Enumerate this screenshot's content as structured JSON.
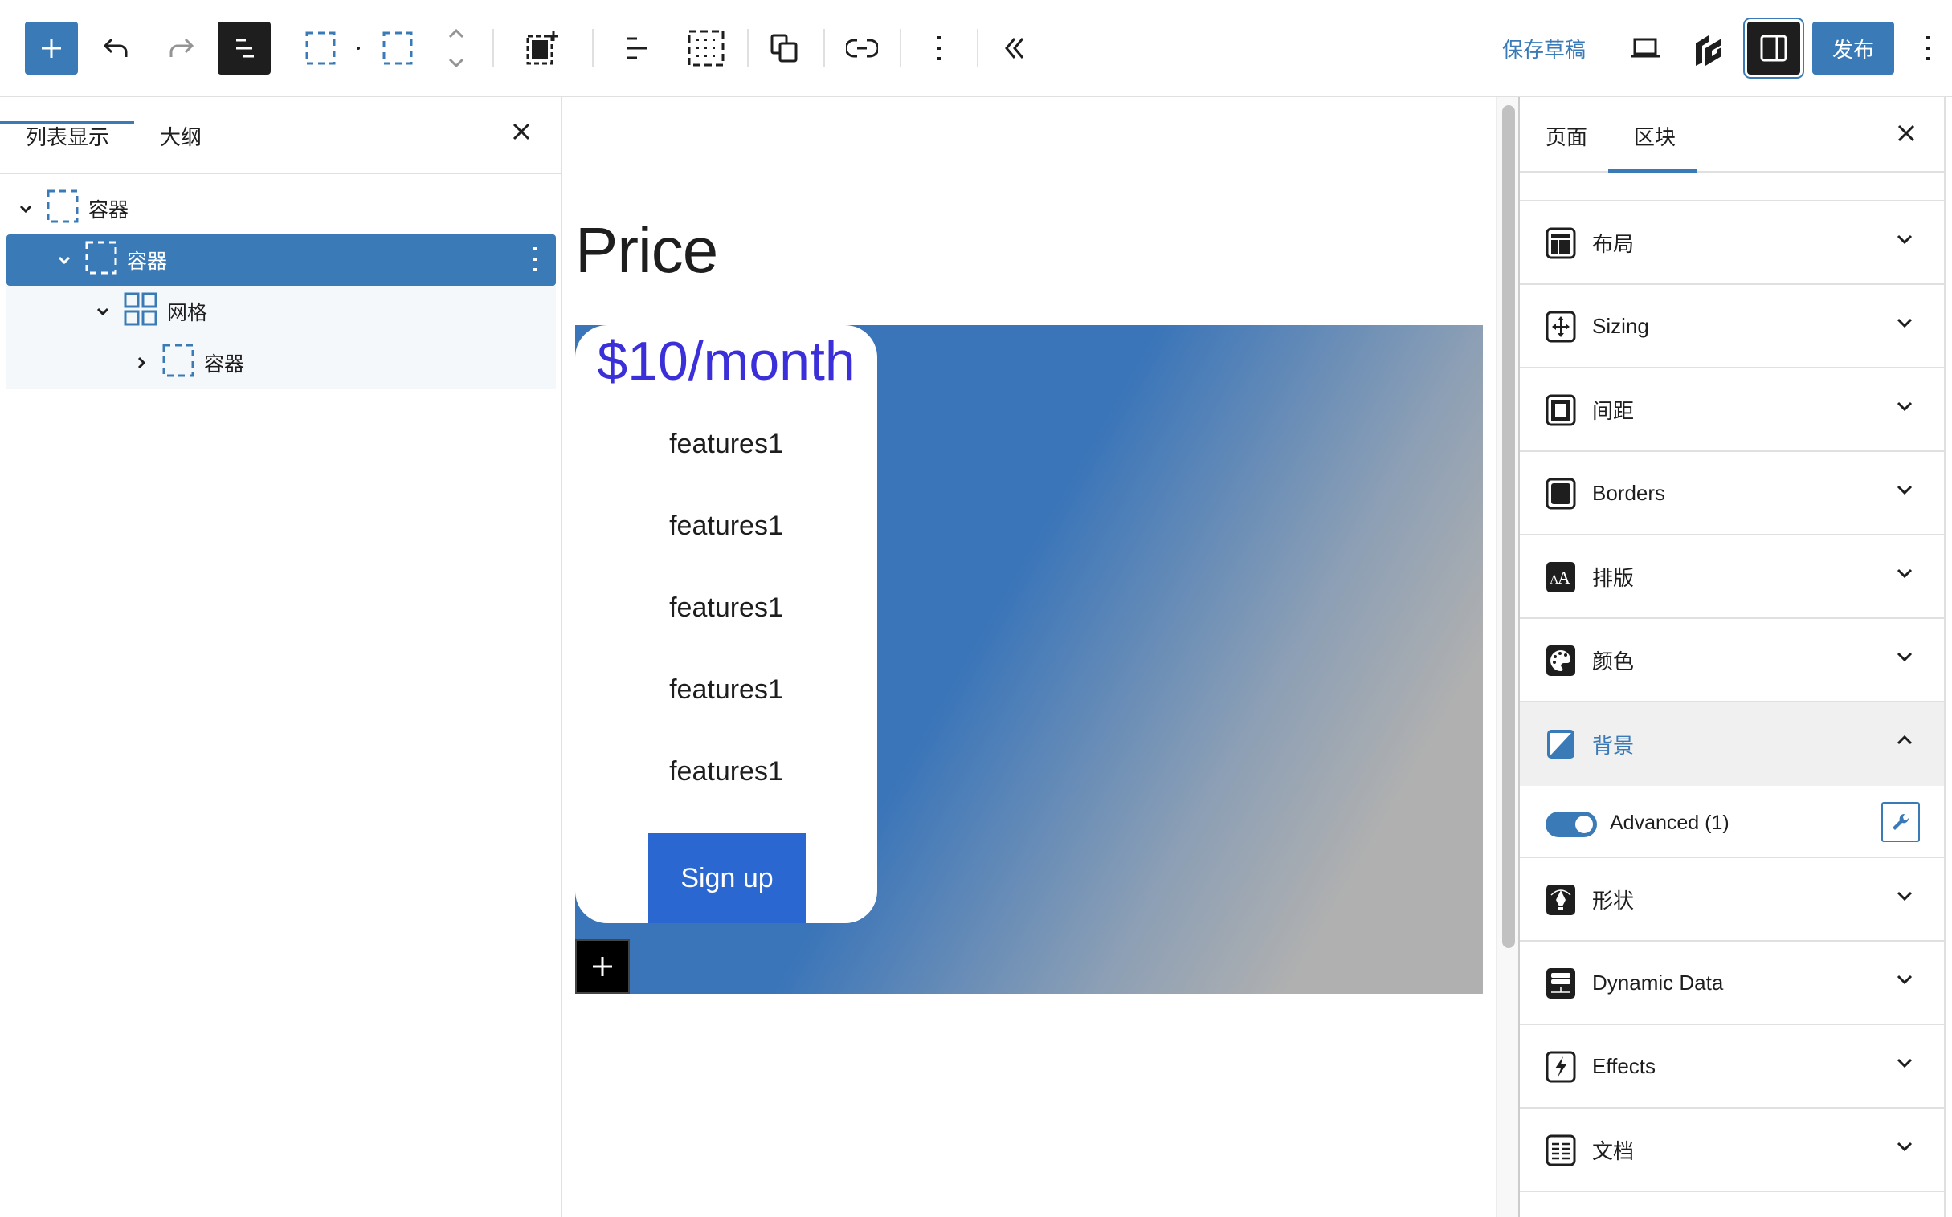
{
  "toolbar": {
    "inserter_icon": "plus-icon",
    "undo_icon": "undo-icon",
    "redo_icon": "redo-icon",
    "list_view_icon": "list-view-icon",
    "block_type_icon": "container-icon",
    "parent_block_icon": "container-icon",
    "move_icon": "chevron-up-down-icon",
    "block_select_icon": "select-parent-icon",
    "align_icon": "justify-left-icon",
    "grid_icon": "grid-dots-icon",
    "duplicate_icon": "copy-icon",
    "link_icon": "link-icon",
    "more_icon": "more-vertical-icon",
    "collapse_icon": "chevrons-left-icon",
    "save_draft": "保存草稿",
    "preview_icon": "laptop-icon",
    "plugin_icon": "generateblocks-icon",
    "settings_icon": "sidebar-icon",
    "publish": "发布",
    "options_icon": "more-vertical-icon"
  },
  "left_panel": {
    "tabs": [
      {
        "label": "列表显示",
        "active": true
      },
      {
        "label": "大纲",
        "active": false
      }
    ],
    "close_icon": "close-icon",
    "tree": [
      {
        "label": "容器",
        "icon": "container-icon",
        "depth": 0,
        "expanded": true,
        "selected": false
      },
      {
        "label": "容器",
        "icon": "container-icon",
        "depth": 1,
        "expanded": true,
        "selected": true
      },
      {
        "label": "网格",
        "icon": "grid-icon",
        "depth": 2,
        "expanded": true,
        "selected": false
      },
      {
        "label": "容器",
        "icon": "container-icon",
        "depth": 3,
        "expanded": false,
        "selected": false
      }
    ]
  },
  "canvas": {
    "heading": "Price",
    "price": "$10/month",
    "features": [
      "features1",
      "features1",
      "features1",
      "features1",
      "features1"
    ],
    "button": "Sign up",
    "add_block_icon": "plus-icon",
    "colors": {
      "price_text": "#3a2fd9",
      "button_bg": "#2b67d0",
      "gradient_start": "#3a75b9",
      "gradient_end": "#b0b0b0"
    }
  },
  "right_panel": {
    "tabs": [
      {
        "label": "页面",
        "active": false
      },
      {
        "label": "区块",
        "active": true
      }
    ],
    "close_icon": "close-icon",
    "panels": [
      {
        "label": "布局",
        "icon": "layout-icon",
        "open": false
      },
      {
        "label": "Sizing",
        "icon": "sizing-icon",
        "open": false
      },
      {
        "label": "间距",
        "icon": "spacing-icon",
        "open": false
      },
      {
        "label": "Borders",
        "icon": "borders-icon",
        "open": false
      },
      {
        "label": "排版",
        "icon": "typography-icon",
        "open": false
      },
      {
        "label": "颜色",
        "icon": "palette-icon",
        "open": false
      },
      {
        "label": "背景",
        "icon": "background-icon",
        "open": true
      },
      {
        "label": "形状",
        "icon": "shape-pen-icon",
        "open": false
      },
      {
        "label": "Dynamic Data",
        "icon": "database-icon",
        "open": false
      },
      {
        "label": "Effects",
        "icon": "lightning-icon",
        "open": false
      },
      {
        "label": "文档",
        "icon": "document-icon",
        "open": false
      }
    ],
    "background_advanced": {
      "label": "Advanced (1)",
      "toggle_on": true,
      "settings_icon": "wrench-icon"
    }
  },
  "accent_color": "#3a7bb7"
}
